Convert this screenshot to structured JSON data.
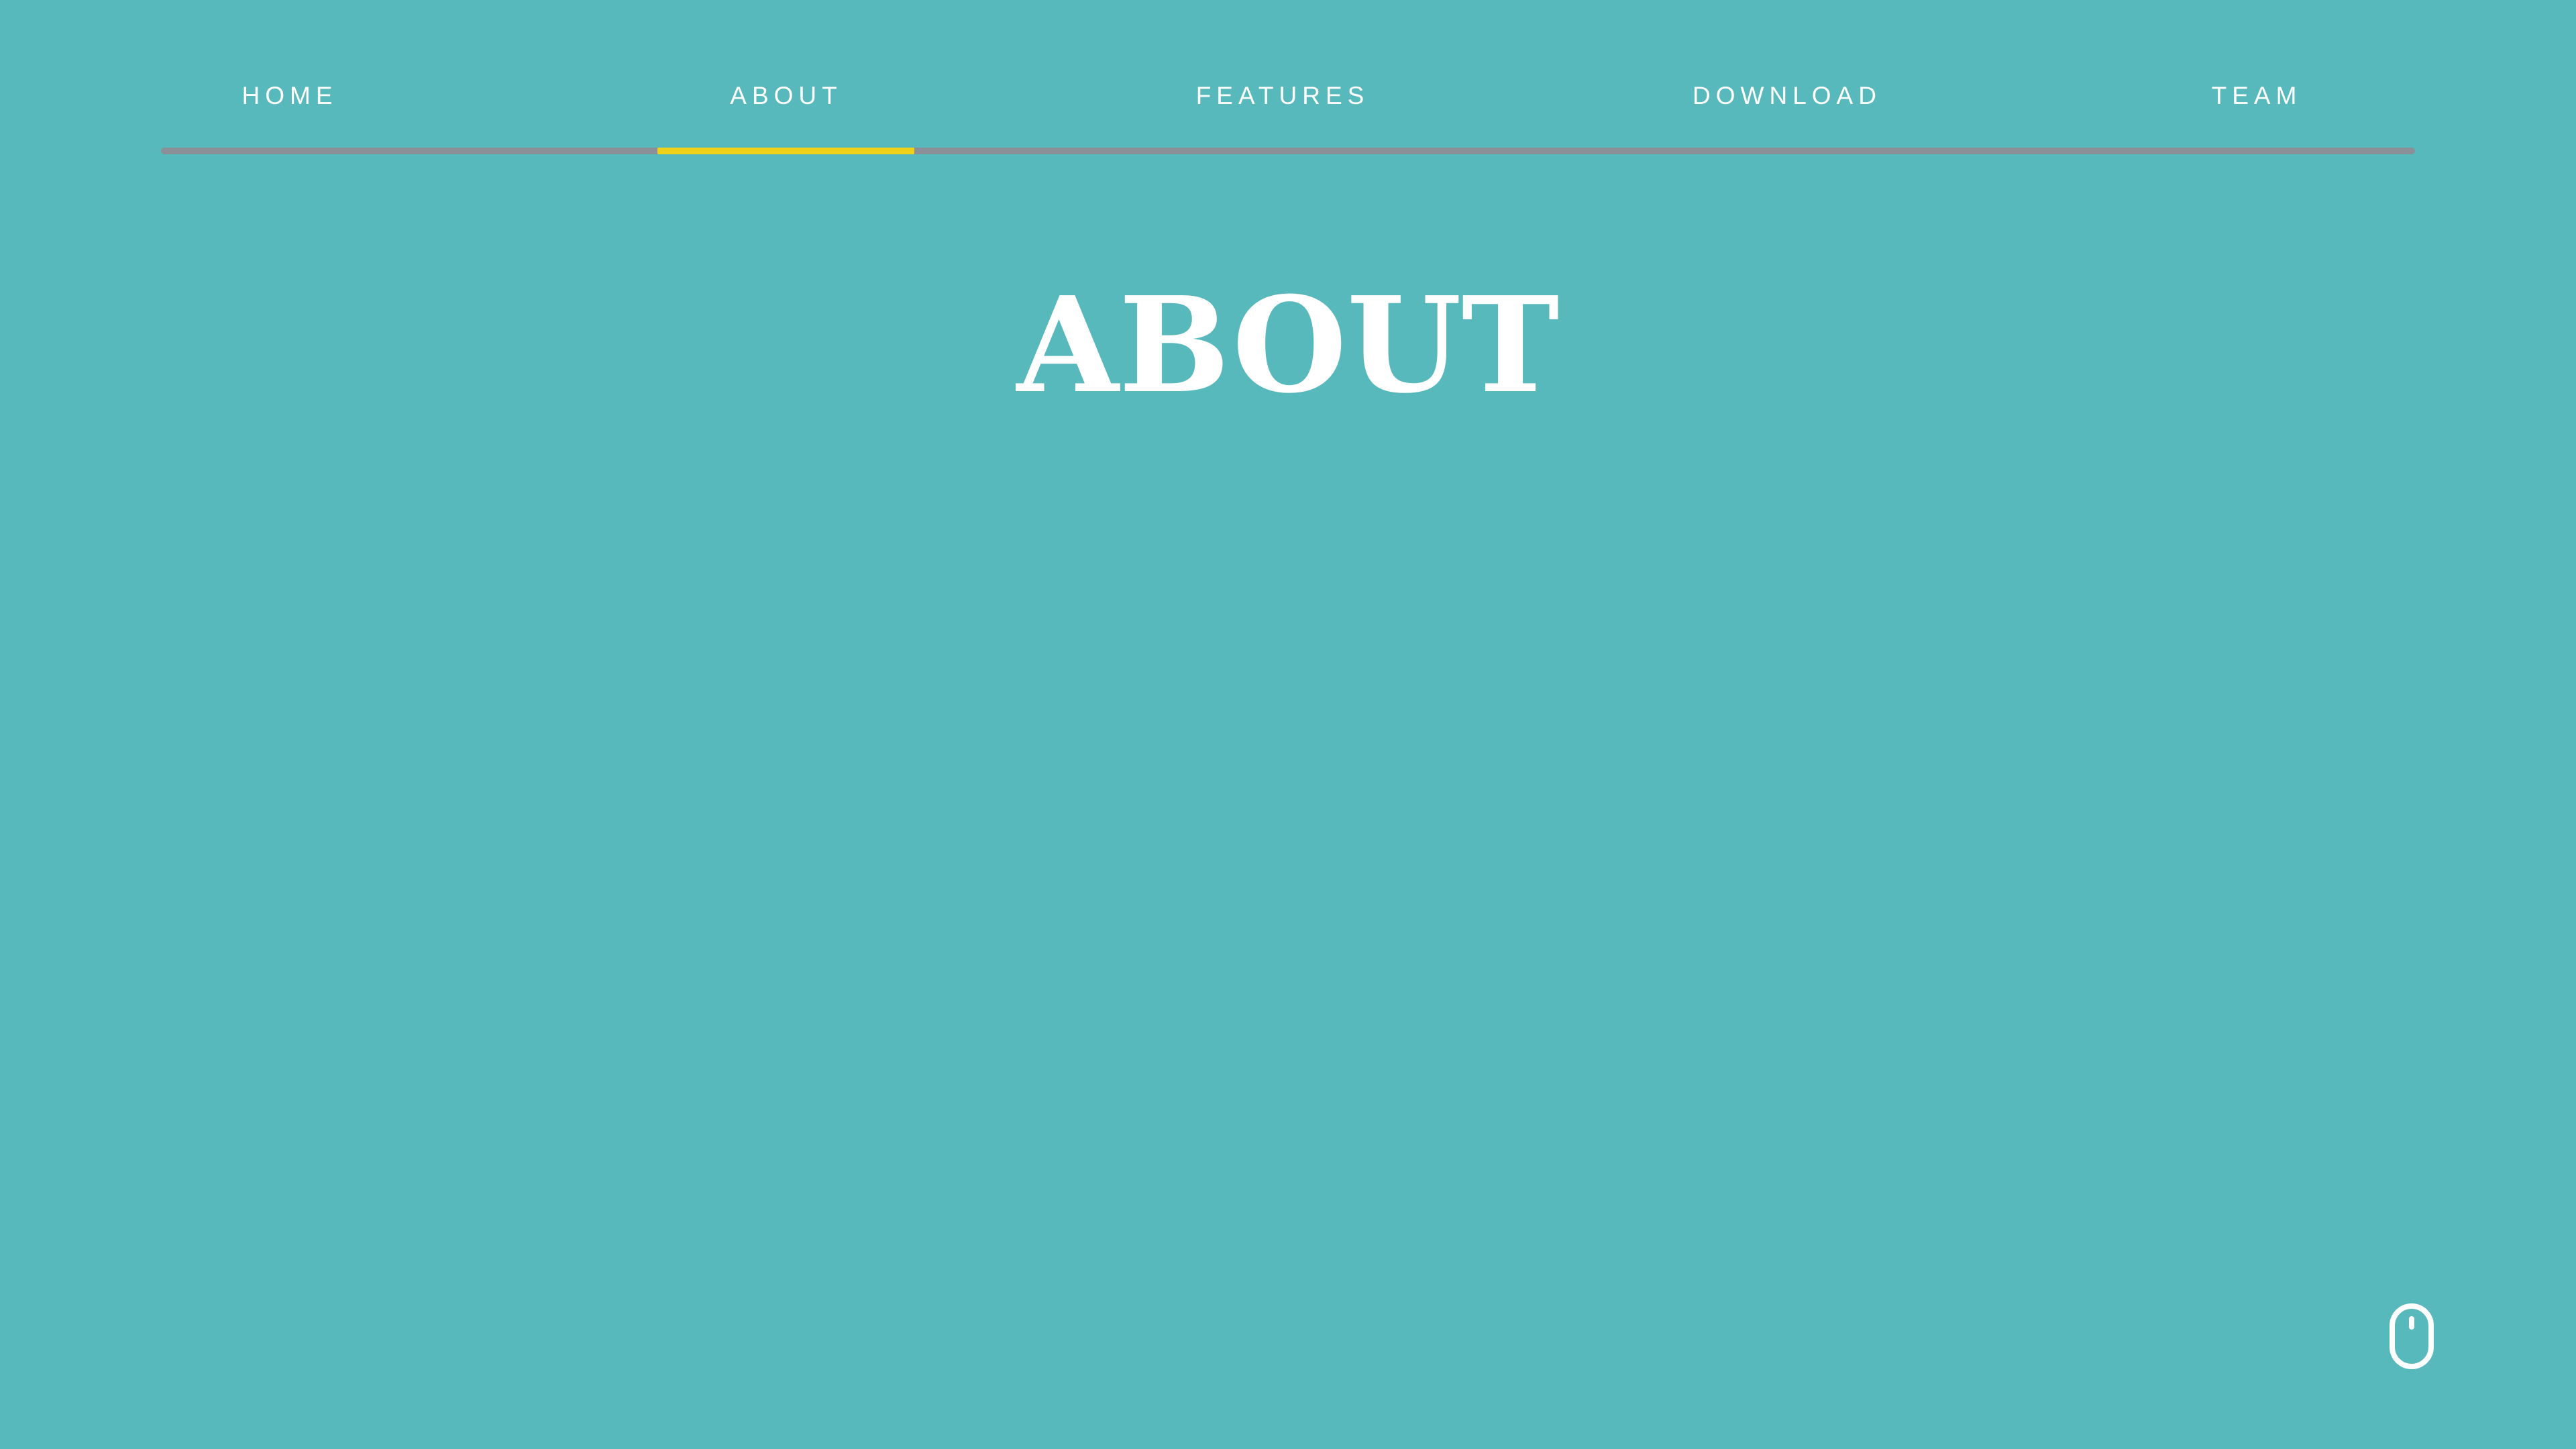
{
  "colors": {
    "background": "#58b9bc",
    "text": "#ffffff",
    "nav_track": "#8b8f97",
    "nav_active": "#f0d11a"
  },
  "nav": {
    "active": "ABOUT",
    "items": [
      {
        "label": "HOME"
      },
      {
        "label": "ABOUT"
      },
      {
        "label": "FEATURES"
      },
      {
        "label": "DOWNLOAD"
      },
      {
        "label": "TEAM"
      }
    ]
  },
  "main": {
    "title": "ABOUT"
  },
  "scroll_indicator": {
    "icon": "mouse-icon"
  }
}
